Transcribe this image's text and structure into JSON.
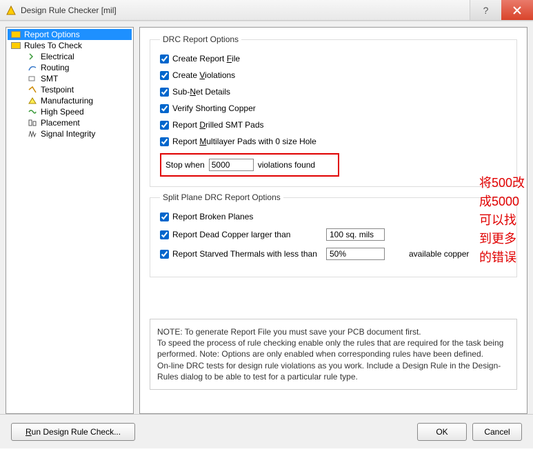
{
  "title": "Design Rule Checker [mil]",
  "tree": {
    "items": [
      {
        "label": "Report Options",
        "selected": true,
        "icon": "options"
      },
      {
        "label": "Rules To Check",
        "selected": false,
        "icon": "options"
      },
      {
        "label": "Electrical",
        "indent": 1,
        "icon": "electrical"
      },
      {
        "label": "Routing",
        "indent": 1,
        "icon": "routing"
      },
      {
        "label": "SMT",
        "indent": 1,
        "icon": "smt"
      },
      {
        "label": "Testpoint",
        "indent": 1,
        "icon": "testpoint"
      },
      {
        "label": "Manufacturing",
        "indent": 1,
        "icon": "manufacturing"
      },
      {
        "label": "High Speed",
        "indent": 1,
        "icon": "highspeed"
      },
      {
        "label": "Placement",
        "indent": 1,
        "icon": "placement"
      },
      {
        "label": "Signal Integrity",
        "indent": 1,
        "icon": "signal"
      }
    ]
  },
  "drc_options": {
    "legend": "DRC Report Options",
    "create_report_file": {
      "checked": true,
      "label_pre": "Create Report ",
      "label_u": "F",
      "label_post": "ile"
    },
    "create_violations": {
      "checked": true,
      "label_pre": "Create ",
      "label_u": "V",
      "label_post": "iolations"
    },
    "subnet_details": {
      "checked": true,
      "label_pre": "Sub-",
      "label_u": "N",
      "label_post": "et Details"
    },
    "verify_shorting": {
      "checked": true,
      "label": "Verify Shorting Copper"
    },
    "report_drilled": {
      "checked": true,
      "label_pre": "Report ",
      "label_u": "D",
      "label_post": "rilled SMT Pads"
    },
    "report_multilayer": {
      "checked": true,
      "label_pre": "Report ",
      "label_u": "M",
      "label_post": "ultilayer Pads with 0 size Hole"
    },
    "stop_when": {
      "label_pre": "Stop when",
      "value": "5000",
      "label_post": "violations found"
    }
  },
  "split_plane": {
    "legend": "Split Plane DRC Report Options",
    "broken_planes": {
      "checked": true,
      "label": "Report Broken Planes"
    },
    "dead_copper": {
      "checked": true,
      "label": "Report Dead Copper larger than",
      "value": "100 sq. mils"
    },
    "starved_thermals": {
      "checked": true,
      "label": "Report Starved Thermals with less than",
      "value": "50%",
      "suffix": "available copper"
    }
  },
  "annotation": {
    "line1": "将500改成5000",
    "line2": "可以找到更多的错误"
  },
  "note": "NOTE: To generate Report File you must save your PCB document first.\nTo speed the process of rule checking enable only the rules that are required for the task being performed.  Note: Options are only enabled when corresponding rules have been defined.\nOn-line DRC tests for design rule violations as you work. Include a Design Rule in the Design-Rules dialog to be able to test for a particular rule  type.",
  "buttons": {
    "run": "Run Design Rule Check...",
    "ok": "OK",
    "cancel": "Cancel"
  }
}
